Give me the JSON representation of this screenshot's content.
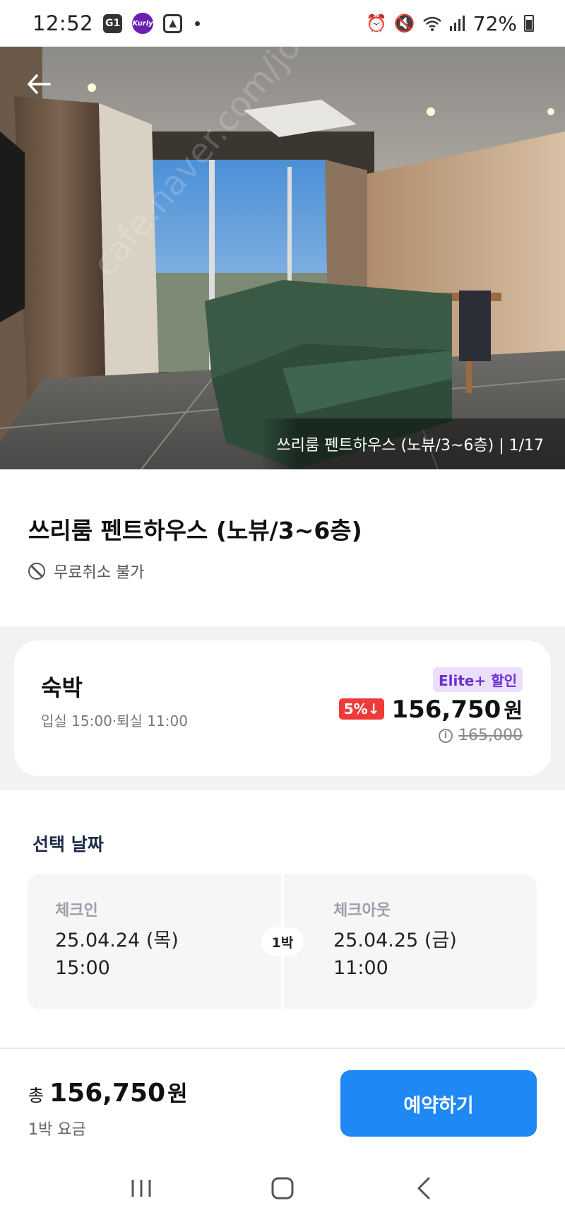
{
  "status_bar": {
    "time": "12:52",
    "app_icons": [
      "G1",
      "Kurly",
      "gallery"
    ],
    "battery": "72%"
  },
  "hero": {
    "caption": "쓰리룸 펜트하우스 (노뷰/3~6층) | 1/17",
    "watermark": "cafe.naver.com/joonggonara"
  },
  "room": {
    "title": "쓰리룸 펜트하우스 (노뷰/3~6층)",
    "policy": "무료취소 불가"
  },
  "stay_card": {
    "title": "숙박",
    "times": "입실 15:00·퇴실 11:00",
    "badge": "Elite+ 할인",
    "discount": "5%↓",
    "price": "156,750",
    "currency": "원",
    "original_price": "165,000",
    "accent_colors": {
      "discount": "#ef3a3a",
      "elite": "#6b2fd2"
    }
  },
  "dates": {
    "heading": "선택 날짜",
    "check_in": {
      "label": "체크인",
      "date": "25.04.24 (목)",
      "time": "15:00"
    },
    "check_out": {
      "label": "체크아웃",
      "date": "25.04.25 (금)",
      "time": "11:00"
    },
    "nights": "1박"
  },
  "bottom_bar": {
    "total_prefix": "총",
    "total_price": "156,750",
    "currency": "원",
    "subtitle": "1박 요금",
    "book_label": "예약하기",
    "accent_color": "#1e88f5"
  },
  "nav_bar": {
    "buttons": [
      "recent-apps-icon",
      "home-icon",
      "back-icon"
    ]
  }
}
